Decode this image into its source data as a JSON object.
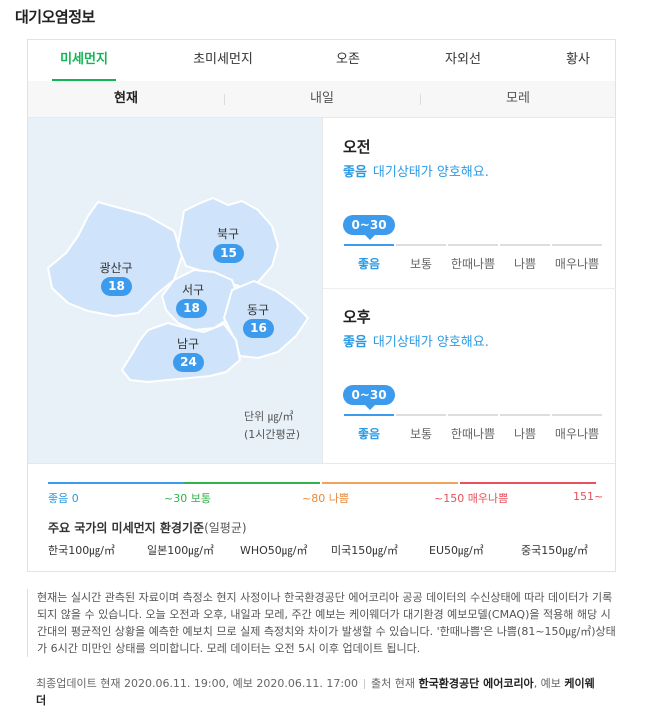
{
  "title": "대기오염정보",
  "tabs": [
    "미세먼지",
    "초미세먼지",
    "오존",
    "자외선",
    "황사"
  ],
  "subtabs": [
    "현재",
    "내일",
    "모레"
  ],
  "districts": [
    {
      "name": "북구",
      "value": "15"
    },
    {
      "name": "광산구",
      "value": "18"
    },
    {
      "name": "서구",
      "value": "18"
    },
    {
      "name": "동구",
      "value": "16"
    },
    {
      "name": "남구",
      "value": "24"
    }
  ],
  "unit": {
    "line1": "단위 ㎍/㎥",
    "line2": "(1시간평균)"
  },
  "periods": [
    {
      "label": "오전",
      "grade": "좋음",
      "desc": "대기상태가 양호해요.",
      "range": "0~30"
    },
    {
      "label": "오후",
      "grade": "좋음",
      "desc": "대기상태가 양호해요.",
      "range": "0~30"
    }
  ],
  "scale_labels": [
    "좋음",
    "보통",
    "한때나쁨",
    "나쁨",
    "매우나쁨"
  ],
  "legend": [
    "좋음 0",
    "~30 보통",
    "~80 나쁨",
    "~150 매우나쁨",
    "151~"
  ],
  "standards": {
    "title": "주요 국가의 미세먼지 환경기준",
    "subtitle": "(일평균)",
    "items": [
      "한국100㎍/㎥",
      "일본100㎍/㎥",
      "WHO50㎍/㎥",
      "미국150㎍/㎥",
      "EU50㎍/㎥",
      "중국150㎍/㎥"
    ]
  },
  "notes": "현재는 실시간 관측된 자료이며 측정소 현지 사정이나 한국환경공단 에어코리아 공공 데이터의 수신상태에 따라 데이터가 기록되지 않을 수 있습니다. 오늘 오전과 오후, 내일과 모레, 주간 예보는 케이웨더가 대기환경 예보모델(CMAQ)을 적용해 해당 시간대의 평균적인 상황을 예측한 예보치 므로 실제 측정치와 차이가 발생할 수 있습니다. '한때나쁨'은 나쁨(81~150㎍/㎥)상태가 6시간 미만인 상태를 의미합니다. 모레 데이터는 오전 5시 이후 업데이트 됩니다.",
  "update": {
    "text": "최종업데이트 현재 2020.06.11. 19:00, 예보 2020.06.11. 17:00",
    "source_prefix": "출처 현재",
    "source_current": "한국환경공단 에어코리아",
    "source_forecast_prefix": ", 예보",
    "source_forecast": "케이웨더"
  },
  "colors": {
    "accent": "#12b553",
    "good": "#3d9bee",
    "normal": "#32b34a",
    "bad": "#f0a35a",
    "very_bad": "#e8505b",
    "map_fill": "#cfe4fa"
  }
}
